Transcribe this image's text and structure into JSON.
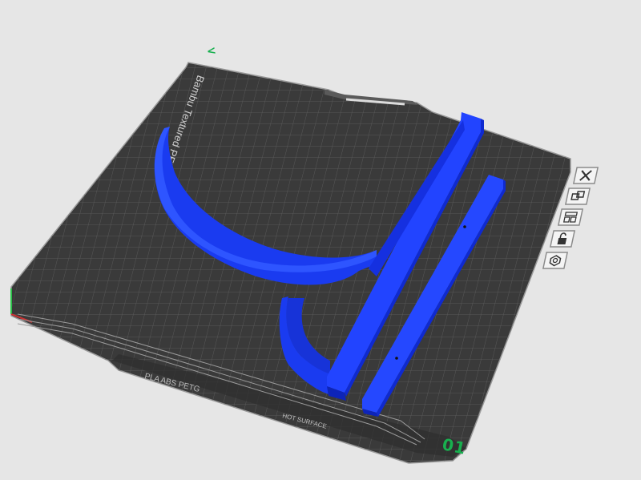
{
  "plate": {
    "brand_label": "Bambu Textured PEI Plate",
    "material_label": "PLA ABS PETG",
    "hot_surface_label": "HOT SURFACE",
    "plate_number": "01",
    "axis_marker": "<"
  },
  "plate_toolbar": {
    "buttons": [
      {
        "name": "close-plate-icon"
      },
      {
        "name": "pick-objects-icon"
      },
      {
        "name": "arrange-icon"
      },
      {
        "name": "lock-plate-icon"
      },
      {
        "name": "plate-settings-icon"
      }
    ]
  },
  "colors": {
    "background": "#e6e6e6",
    "plate": "#3b3b3b",
    "grid": "#6b6b6b",
    "model": "#1e3cff",
    "accent": "#18b04f"
  }
}
